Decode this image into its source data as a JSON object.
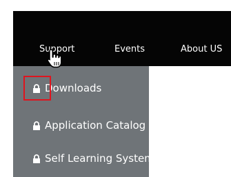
{
  "nav": {
    "items": [
      {
        "label": "Support"
      },
      {
        "label": "Events"
      },
      {
        "label": "About US"
      }
    ]
  },
  "dropdown": {
    "items": [
      {
        "label": "Downloads",
        "icon": "lock-icon"
      },
      {
        "label": "Application Catalog",
        "icon": "lock-icon"
      },
      {
        "label": "Self Learning System",
        "icon": "lock-icon"
      }
    ]
  },
  "colors": {
    "nav_background": "#050505",
    "dropdown_background": "#6f7478",
    "text": "#ffffff",
    "highlight": "#e0141e"
  },
  "cursor": {
    "icon": "hand-pointer-icon"
  }
}
